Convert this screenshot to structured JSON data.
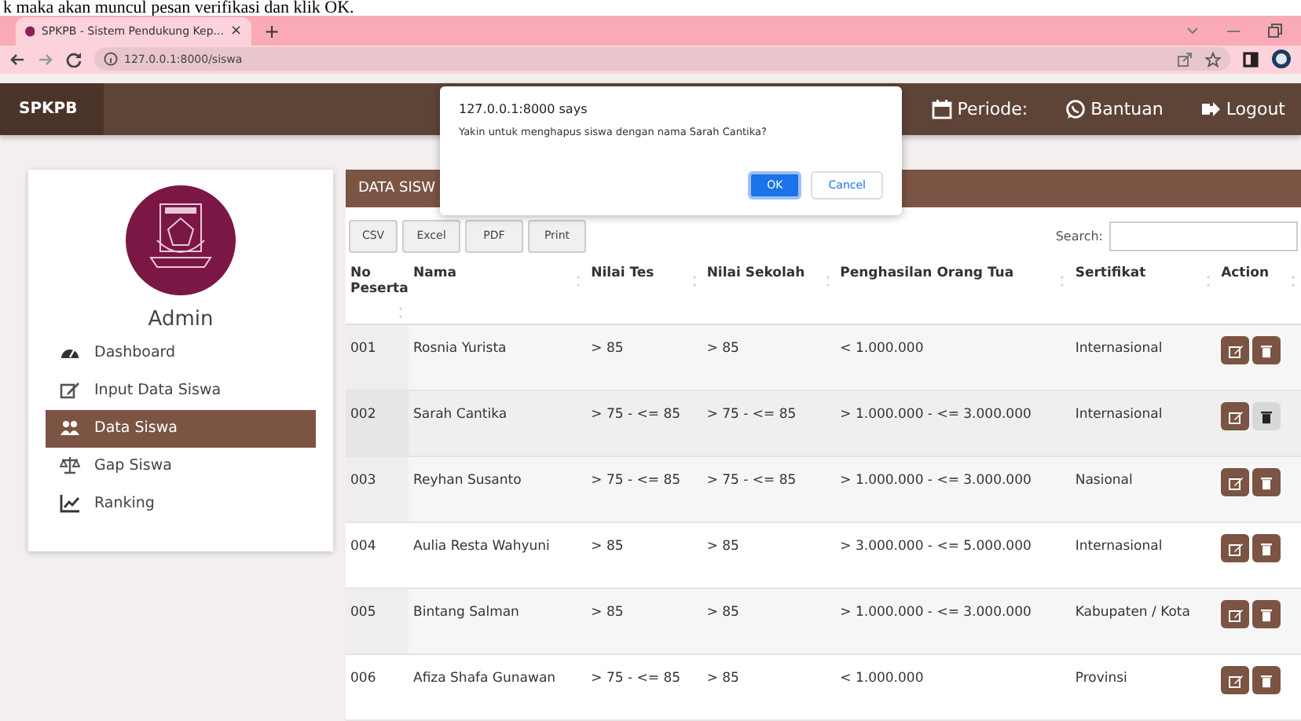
{
  "caption": "k maka akan muncul pesan verifikasi dan klik OK.",
  "browser": {
    "tab_title": "SPKPB - Sistem Pendukung Kep...",
    "tab_close": "×",
    "new_tab": "+",
    "url": "127.0.0.1:8000/siswa"
  },
  "navbar": {
    "brand": "SPKPB",
    "links": [
      {
        "label": "Periode:"
      },
      {
        "label": "Bantuan"
      },
      {
        "label": "Logout"
      }
    ]
  },
  "sidebar": {
    "user": "Admin",
    "items": [
      {
        "label": "Dashboard",
        "selected": false
      },
      {
        "label": "Input Data Siswa",
        "selected": false
      },
      {
        "label": "Data Siswa",
        "selected": true
      },
      {
        "label": "Gap Siswa",
        "selected": false
      },
      {
        "label": "Ranking",
        "selected": false
      }
    ]
  },
  "panel": {
    "title": "DATA SISW",
    "export_buttons": [
      "CSV",
      "Excel",
      "PDF",
      "Print"
    ],
    "search_label": "Search:"
  },
  "table": {
    "columns": [
      "No Peserta",
      "Nama",
      "Nilai Tes",
      "Nilai Sekolah",
      "Penghasilan Orang Tua",
      "Sertifikat",
      "Action"
    ],
    "rows": [
      {
        "cells": [
          "001",
          "Rosnia Yurista",
          "> 85",
          "> 85",
          "< 1.000.000",
          "Internasional"
        ],
        "hovered": false
      },
      {
        "cells": [
          "002",
          "Sarah Cantika",
          "> 75 - <= 85",
          "> 75 - <= 85",
          "> 1.000.000 - <= 3.000.000",
          "Internasional"
        ],
        "hovered": true
      },
      {
        "cells": [
          "003",
          "Reyhan Susanto",
          "> 75 - <= 85",
          "> 75 - <= 85",
          "> 1.000.000 - <= 3.000.000",
          "Nasional"
        ],
        "hovered": false
      },
      {
        "cells": [
          "004",
          "Aulia Resta Wahyuni",
          "> 85",
          "> 85",
          "> 3.000.000 - <= 5.000.000",
          "Internasional"
        ],
        "hovered": false
      },
      {
        "cells": [
          "005",
          "Bintang Salman",
          "> 85",
          "> 85",
          "> 1.000.000 - <= 3.000.000",
          "Kabupaten / Kota"
        ],
        "hovered": false
      },
      {
        "cells": [
          "006",
          "Afiza Shafa Gunawan",
          "> 75 - <= 85",
          "> 85",
          "< 1.000.000",
          "Provinsi"
        ],
        "hovered": false
      }
    ]
  },
  "dialog": {
    "title": "127.0.0.1:8000 says",
    "message": "Yakin untuk menghapus siswa dengan nama Sarah Cantika?",
    "buttons": [
      {
        "label": "OK",
        "kind": "primary"
      },
      {
        "label": "Cancel",
        "kind": "secondary"
      }
    ]
  }
}
